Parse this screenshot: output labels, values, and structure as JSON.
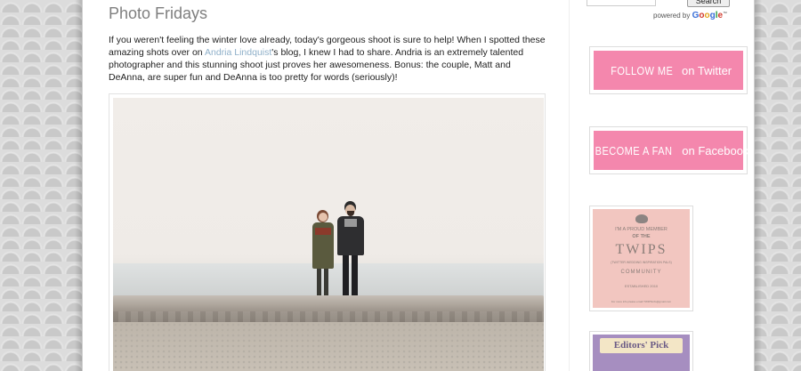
{
  "post": {
    "title": "Photo Fridays",
    "body_part1": "If you weren't feeling the winter love already, today's gorgeous shoot is sure to help! When I spotted these amazing shots over on ",
    "body_link": "Andria Lindquist",
    "body_part2": "'s blog, I knew I had to share. Andria is an extremely talented photographer and this stunning shoot just proves her awesomeness. Bonus: the couple, Matt and DeAnna, are super fun and DeAnna is too pretty for words (seriously)!"
  },
  "sidebar": {
    "search_button": "Search",
    "powered_by": "powered by",
    "google": "Google",
    "twitter": {
      "caps": "FOLLOW ME",
      "rest": " on Twitter"
    },
    "facebook": {
      "caps": "BECOME A FAN",
      "rest": " on Facebook"
    },
    "twips": {
      "line1": "I'M A PROUD MEMBER",
      "line2": "OF THE",
      "name": "TWIPS",
      "sub": "(TWITTER WEDDING INSPIRATION PALS)",
      "community": "COMMUNITY",
      "established": "ESTABLISHED 2010",
      "footer": "For more info please email TWIPSinfo@gmail.com"
    },
    "editors_pick": "Editors' Pick"
  },
  "colors": {
    "accent_pink": "#f487ad",
    "link": "#8fb0c9",
    "title_gray": "#7f7f7f"
  }
}
